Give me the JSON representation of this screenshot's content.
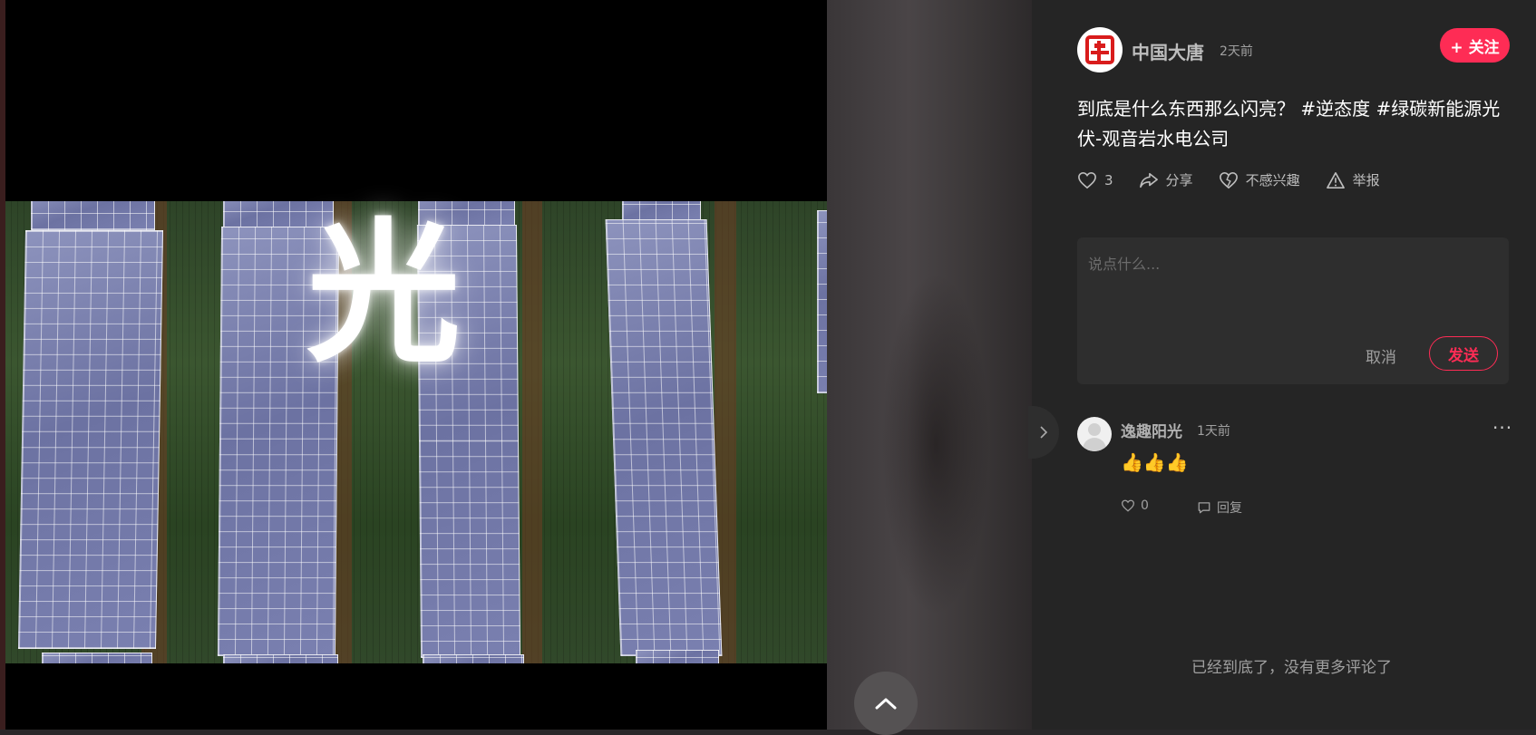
{
  "author": {
    "name": "中国大唐",
    "time": "2天前",
    "avatar_glyph": "唐",
    "follow_label": "+ 关注"
  },
  "post": {
    "text": "到底是什么东西那么闪亮？",
    "tags": [
      "#逆态度",
      "#绿碳新能源光伏-观音岩水电公司"
    ]
  },
  "actions": {
    "like_count": "3",
    "share_label": "分享",
    "not_interested_label": "不感兴趣",
    "report_label": "举报"
  },
  "comment_form": {
    "placeholder": "说点什么...",
    "cancel_label": "取消",
    "send_label": "发送"
  },
  "comments": [
    {
      "user": "逸趣阳光",
      "time": "1天前",
      "text": "👍👍👍",
      "likes": "0",
      "reply_label": "回复"
    }
  ],
  "video": {
    "overlay_text": "光"
  },
  "footer_note": "已经到底了，没有更多评论了",
  "colors": {
    "accent": "#fe2c55",
    "panel_bg": "#252525",
    "muted_text": "#a0a0a0"
  }
}
